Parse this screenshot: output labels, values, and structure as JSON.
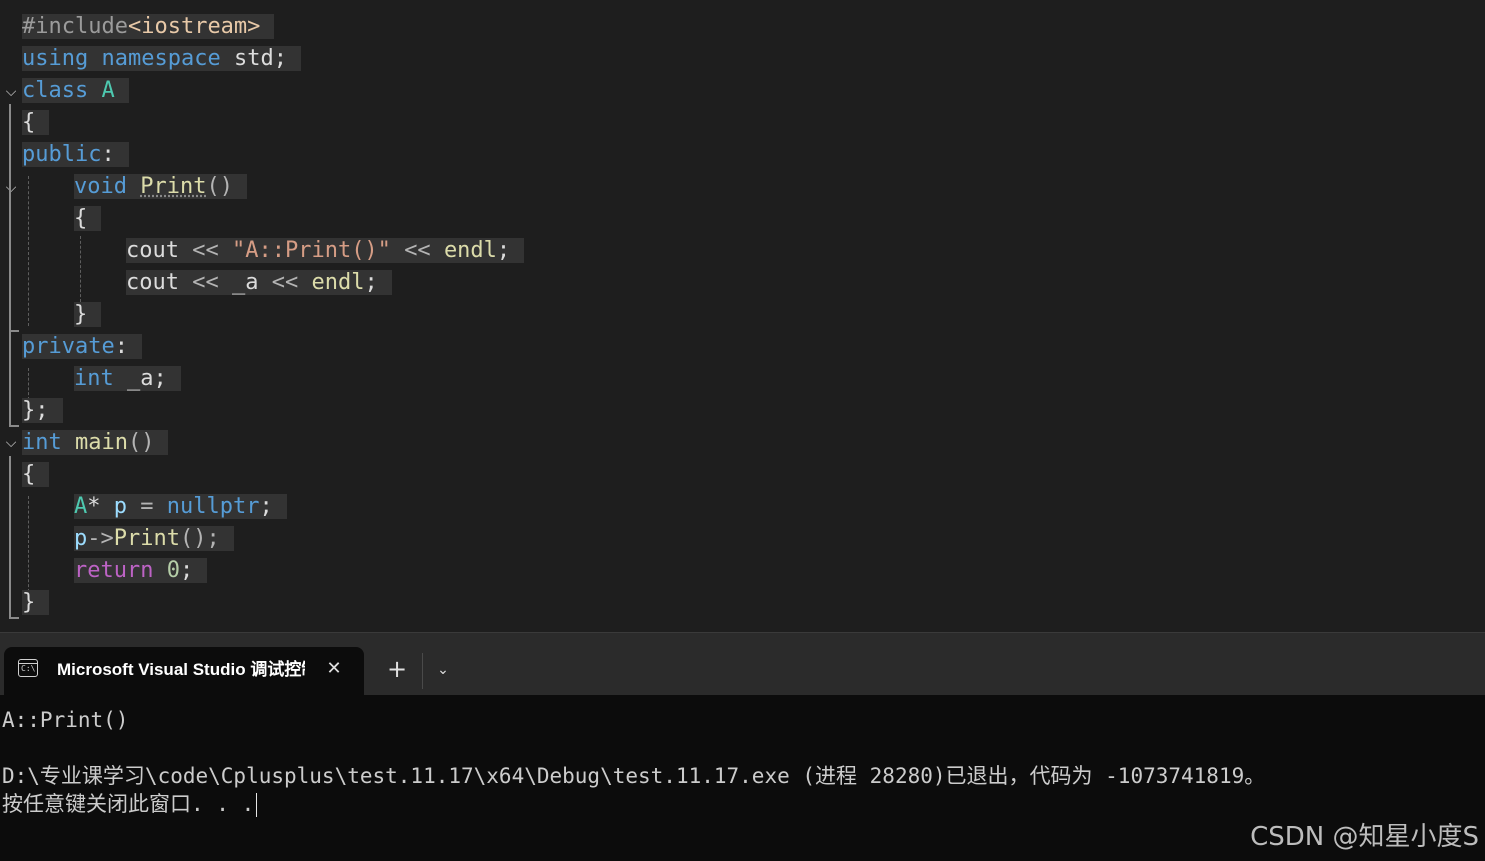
{
  "editor": {
    "lines": {
      "l1": {
        "a": "#include",
        "b": "<iostream>"
      },
      "l2": {
        "a": "using",
        "b": "namespace",
        "c": "std",
        "d": ";"
      },
      "l3": {
        "a": "class",
        "b": "A"
      },
      "l4": {
        "a": "{"
      },
      "l5": {
        "a": "public",
        "b": ":"
      },
      "l6": {
        "a": "void",
        "b": "Print",
        "c": "()"
      },
      "l7": {
        "a": "{"
      },
      "l8": {
        "a": "cout",
        "b": "<<",
        "c": "\"A::Print()\"",
        "d": "<<",
        "e": "endl",
        "f": ";"
      },
      "l9": {
        "a": "cout",
        "b": "<<",
        "c": "_a",
        "d": "<<",
        "e": "endl",
        "f": ";"
      },
      "l10": {
        "a": "}"
      },
      "l11": {
        "a": "private",
        "b": ":"
      },
      "l12": {
        "a": "int",
        "b": "_a",
        "c": ";"
      },
      "l13": {
        "a": "};"
      },
      "l14": {
        "a": "int",
        "b": "main",
        "c": "()"
      },
      "l15": {
        "a": "{"
      },
      "l16": {
        "a": "A",
        "b": "*",
        "c": "p",
        "d": "=",
        "e": "nullptr",
        "f": ";"
      },
      "l17": {
        "a": "p",
        "b": "->",
        "c": "Print",
        "d": "();"
      },
      "l18": {
        "a": "return",
        "b": "0",
        "c": ";"
      },
      "l19": {
        "a": "}"
      }
    },
    "fold_glyph": "chevron-down-icon"
  },
  "console": {
    "tab_title": "Microsoft Visual Studio 调试控制台",
    "tab_icon_text": "C:\\",
    "close_glyph": "✕",
    "new_tab_glyph": "+",
    "dropdown_glyph": "⌄",
    "output": {
      "line1": "A::Print()",
      "line2": "D:\\专业课学习\\code\\Cplusplus\\test.11.17\\x64\\Debug\\test.11.17.exe (进程 28280)已退出，代码为 -1073741819。",
      "line3": "按任意键关闭此窗口. . ."
    }
  },
  "watermark": "CSDN @知星小度S"
}
